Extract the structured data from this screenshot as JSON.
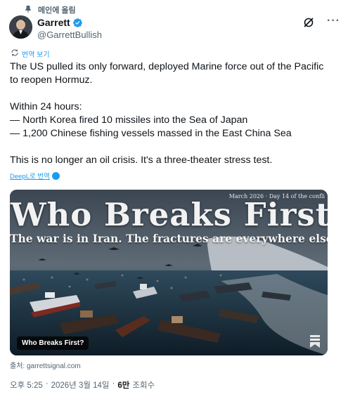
{
  "pinned": {
    "label": "메인에 올림"
  },
  "author": {
    "display_name": "Garrett",
    "handle": "@GarrettBullish"
  },
  "actions": {
    "grok_icon": "grok-icon",
    "more_icon": "more-icon"
  },
  "translate": {
    "label": "번역 보기"
  },
  "tweet": {
    "lines": [
      "The US pulled its only forward, deployed Marine force out of the Pacific",
      "to reopen Hormuz.",
      "",
      "Within 24 hours:",
      "— North Korea fired 10 missiles into the Sea of Japan",
      "— 1,200 Chinese fishing vessels massed in the East China Sea",
      "",
      "This is no longer an oil crisis. It's a three-theater stress test."
    ]
  },
  "deepl": {
    "label": "DeepL로 번역"
  },
  "media": {
    "date_text": "March 2026 · Day 14 of the confli",
    "headline": "Who Breaks First",
    "subline": "The war is in Iran. The fractures are everywhere else",
    "caption": "Who Breaks First?"
  },
  "source": {
    "label": "출처: garrettsignal.com"
  },
  "meta": {
    "time": "오후 5:25",
    "separator": "·",
    "date": "2026년 3월 14일",
    "separator2": "·",
    "views_count": "6만",
    "views_label": "조회수"
  },
  "colors": {
    "accent": "#1d9bf0",
    "secondary_text": "#536471",
    "primary_text": "#0f1419"
  }
}
